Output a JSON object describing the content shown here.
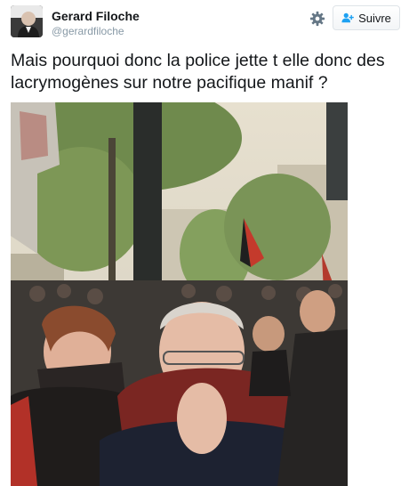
{
  "user": {
    "name": "Gerard Filoche",
    "handle": "@gerardfiloche"
  },
  "actions": {
    "follow_label": "Suivre",
    "follow_icon": "add-user-icon",
    "settings_icon": "gear-icon"
  },
  "tweet": {
    "text": "Mais pourquoi donc la police jette t elle donc des lacrymogènes sur notre pacifique manif ?"
  },
  "colors": {
    "accent": "#1da1f2",
    "text": "#14171a",
    "muted": "#8899a6"
  }
}
